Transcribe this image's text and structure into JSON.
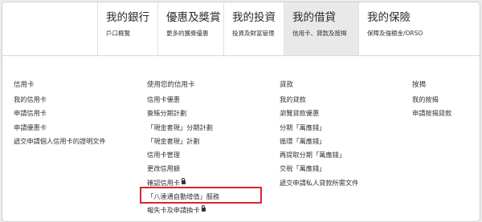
{
  "nav": {
    "items": [
      {
        "title": "我的銀行",
        "sub": "戶口概覽"
      },
      {
        "title": "優惠及獎賞",
        "sub": "更多的獲獎優惠"
      },
      {
        "title": "我的投資",
        "sub": "投資及財富管理"
      },
      {
        "title": "我的借貸",
        "sub": "信用卡、貸款及按揭",
        "active": true
      },
      {
        "title": "我的保險",
        "sub": "保障及強積金/ORSO"
      }
    ]
  },
  "columns": [
    {
      "heading": "信用卡",
      "links": [
        {
          "label": "我的信用卡"
        },
        {
          "label": "申請信用卡"
        },
        {
          "label": "申請優惠卡"
        },
        {
          "label": "遞交申請個人信用卡的證明文件"
        }
      ]
    },
    {
      "heading": "使用您的信用卡",
      "links": [
        {
          "label": "信用卡優惠"
        },
        {
          "label": "簽賬分期計劃"
        },
        {
          "label": "「現金套現」分期計劃"
        },
        {
          "label": "「現金套現」計劃"
        },
        {
          "label": "信用卡管理"
        },
        {
          "label": "更改信用額"
        },
        {
          "label": "確認信用卡",
          "locked": true
        },
        {
          "label": "「八達通自動增值」服務",
          "highlighted": true
        },
        {
          "label": "報失卡及申請換卡",
          "locked": true
        }
      ]
    },
    {
      "heading": "貸款",
      "links": [
        {
          "label": "我的貸款"
        },
        {
          "label": "瀏覽貸款優惠"
        },
        {
          "label": "分期「萬應錢」"
        },
        {
          "label": "循環「萬應錢」"
        },
        {
          "label": "再提取分期「萬應錢」"
        },
        {
          "label": "交税「萬應錢」"
        },
        {
          "label": "遞交申請私人貸款所需文件"
        }
      ]
    },
    {
      "heading": "按揭",
      "links": [
        {
          "label": "我的按揭"
        },
        {
          "label": "申請按揭貸款"
        }
      ]
    }
  ],
  "colors": {
    "highlight": "#d8262f",
    "active_tab": "#e9e9e9"
  }
}
